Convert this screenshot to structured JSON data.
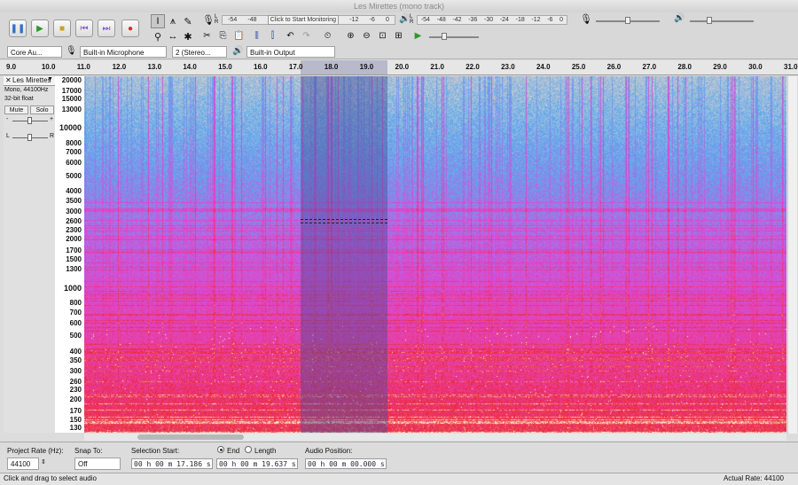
{
  "window": {
    "title": "Les Mirettes (mono track)"
  },
  "transport": {
    "pause": "pause-icon",
    "play": "play-icon",
    "stop": "stop-icon",
    "skip_start": "skip-start-icon",
    "skip_end": "skip-end-icon",
    "record": "record-icon"
  },
  "meters": {
    "record_ticks": [
      "-54",
      "-48",
      "-12",
      "-6",
      "0"
    ],
    "record_prompt": "Click to Start Monitoring",
    "playback_ticks": [
      "-54",
      "-48",
      "-42",
      "-36",
      "-30",
      "-24",
      "-18",
      "-12",
      "-6",
      "0"
    ]
  },
  "devices": {
    "host": "Core Au...",
    "recording_device": "Built-in Microphone",
    "channels": "2 (Stereo...",
    "playback_device": "Built-in Output"
  },
  "ruler": {
    "ticks": [
      "9.0",
      "10.0",
      "11.0",
      "12.0",
      "13.0",
      "14.0",
      "15.0",
      "16.0",
      "17.0",
      "18.0",
      "19.0",
      "20.0",
      "21.0",
      "22.0",
      "23.0",
      "24.0",
      "25.0",
      "26.0",
      "27.0",
      "28.0",
      "29.0",
      "30.0",
      "31.0"
    ],
    "start": 9.0,
    "end": 31.0
  },
  "track": {
    "name": "Les Mirettes",
    "info_line1": "Mono, 44100Hz",
    "info_line2": "32-bit float",
    "mute": "Mute",
    "solo": "Solo",
    "gain_minus": "-",
    "gain_plus": "+",
    "pan_left": "L",
    "pan_right": "R"
  },
  "freq_scale": [
    "20000",
    "17000",
    "15000",
    "13000",
    "10000",
    "8000",
    "7000",
    "6000",
    "5000",
    "4000",
    "3500",
    "3000",
    "2600",
    "2300",
    "2000",
    "1700",
    "1500",
    "1300",
    "1000",
    "800",
    "700",
    "600",
    "500",
    "400",
    "350",
    "300",
    "260",
    "230",
    "200",
    "170",
    "150",
    "130"
  ],
  "selection": {
    "start_seconds": 17.186,
    "end_seconds": 19.637
  },
  "bottom": {
    "project_rate_label": "Project Rate (Hz):",
    "project_rate": "44100",
    "snap_to_label": "Snap To:",
    "snap_to": "Off",
    "selection_start_label": "Selection Start:",
    "selection_start": "00 h 00 m 17.186 s",
    "end_label": "End",
    "length_label": "Length",
    "selection_end": "00 h 00 m 19.637 s",
    "audio_position_label": "Audio Position:",
    "audio_position": "00 h 00 m 00.000 s"
  },
  "status": {
    "left": "Click and drag to select audio",
    "right": "Actual Rate: 44100"
  },
  "colors": {
    "selection": "#5a5f9a",
    "spectrogram_hot": "#e8283c",
    "spectrogram_mid": "#e040c8",
    "spectrogram_cold": "#59a8f0"
  }
}
